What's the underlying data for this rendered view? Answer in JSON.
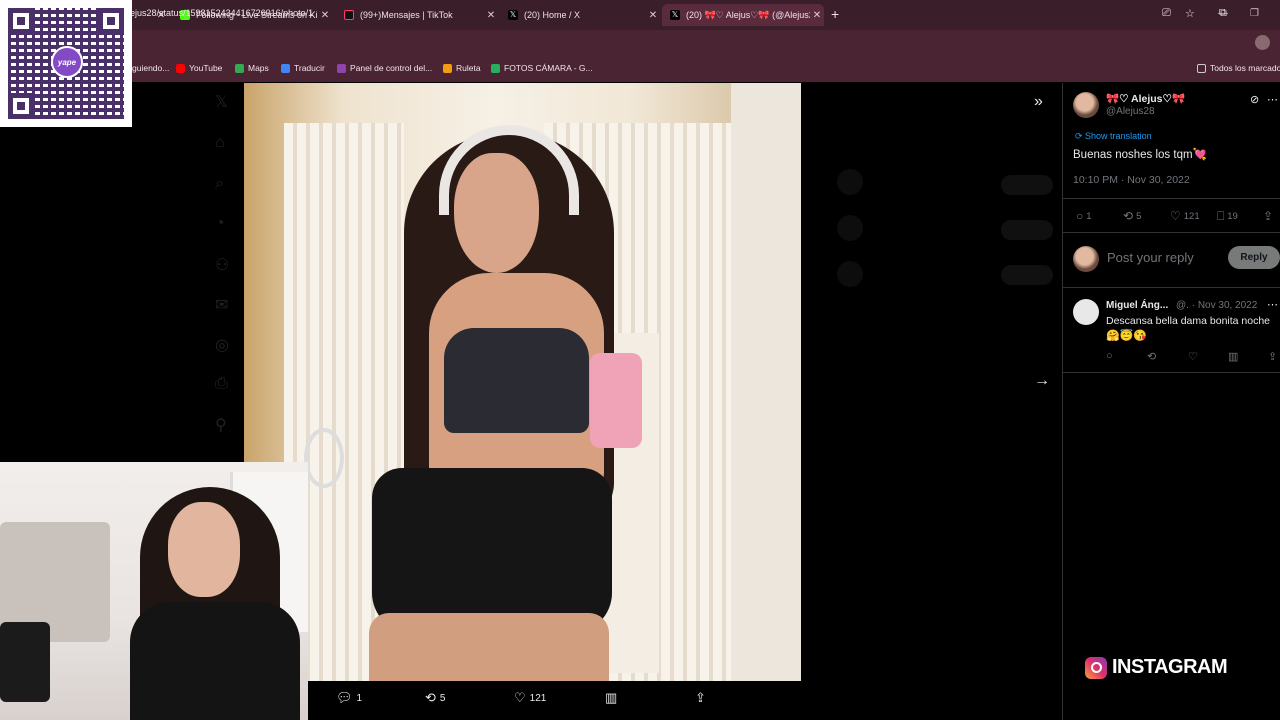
{
  "browser": {
    "tabs": [
      {
        "title": "",
        "icon": "blank-icon"
      },
      {
        "title": "Following - Live Streams on Ki",
        "icon": "kick-icon"
      },
      {
        "title": "(99+)Mensajes | TikTok",
        "icon": "tiktok-icon"
      },
      {
        "title": "(20) Home / X",
        "icon": "x-icon"
      },
      {
        "title": "(20) 🎀♡ Alejus♡🎀 (@Alejus2",
        "icon": "x-icon"
      }
    ],
    "new_tab": "+",
    "url": "ejus28/status/1598152434416726016/photo/1",
    "bookmarks": [
      {
        "label": "guiendo...",
        "color": "#4caf50"
      },
      {
        "label": "YouTube",
        "color": "#ff0000"
      },
      {
        "label": "Maps",
        "color": "#34a853"
      },
      {
        "label": "Traducir",
        "color": "#4285f4"
      },
      {
        "label": "Panel de control del...",
        "color": "#8e44ad"
      },
      {
        "label": "Ruleta",
        "color": "#f39c12"
      },
      {
        "label": "FOTOS CÁMARA - G...",
        "color": "#27ae60"
      },
      {
        "label": "Todos los marcado",
        "color": "#cccccc"
      }
    ]
  },
  "photo_actions": {
    "replies": "1",
    "reposts": "5",
    "likes": "121"
  },
  "tweet": {
    "display_name": "🎀♡ Alejus♡🎀",
    "handle": "@Alejus28",
    "show_translation": "Show translation",
    "text": "Buenas noshes los tqm💘",
    "timestamp": "10:10 PM · Nov 30, 2022",
    "stats": {
      "replies": "1",
      "reposts": "5",
      "likes": "121",
      "bookmarks": "19"
    },
    "reply_placeholder": "Post your reply",
    "reply_button": "Reply"
  },
  "comment": {
    "name": "Miguel Áng...",
    "meta": "@. · Nov 30, 2022",
    "text": "Descansa bella dama bonita noche",
    "emojis": "🤗😇😘"
  },
  "overlay": {
    "qr_label": "yape",
    "instagram_label": "INSTAGRAM"
  },
  "colors": {
    "tab_bar": "#3a1f2a",
    "address_bar": "#4b2433",
    "x_link_blue": "#1d9bf0",
    "x_muted": "#71767b"
  }
}
